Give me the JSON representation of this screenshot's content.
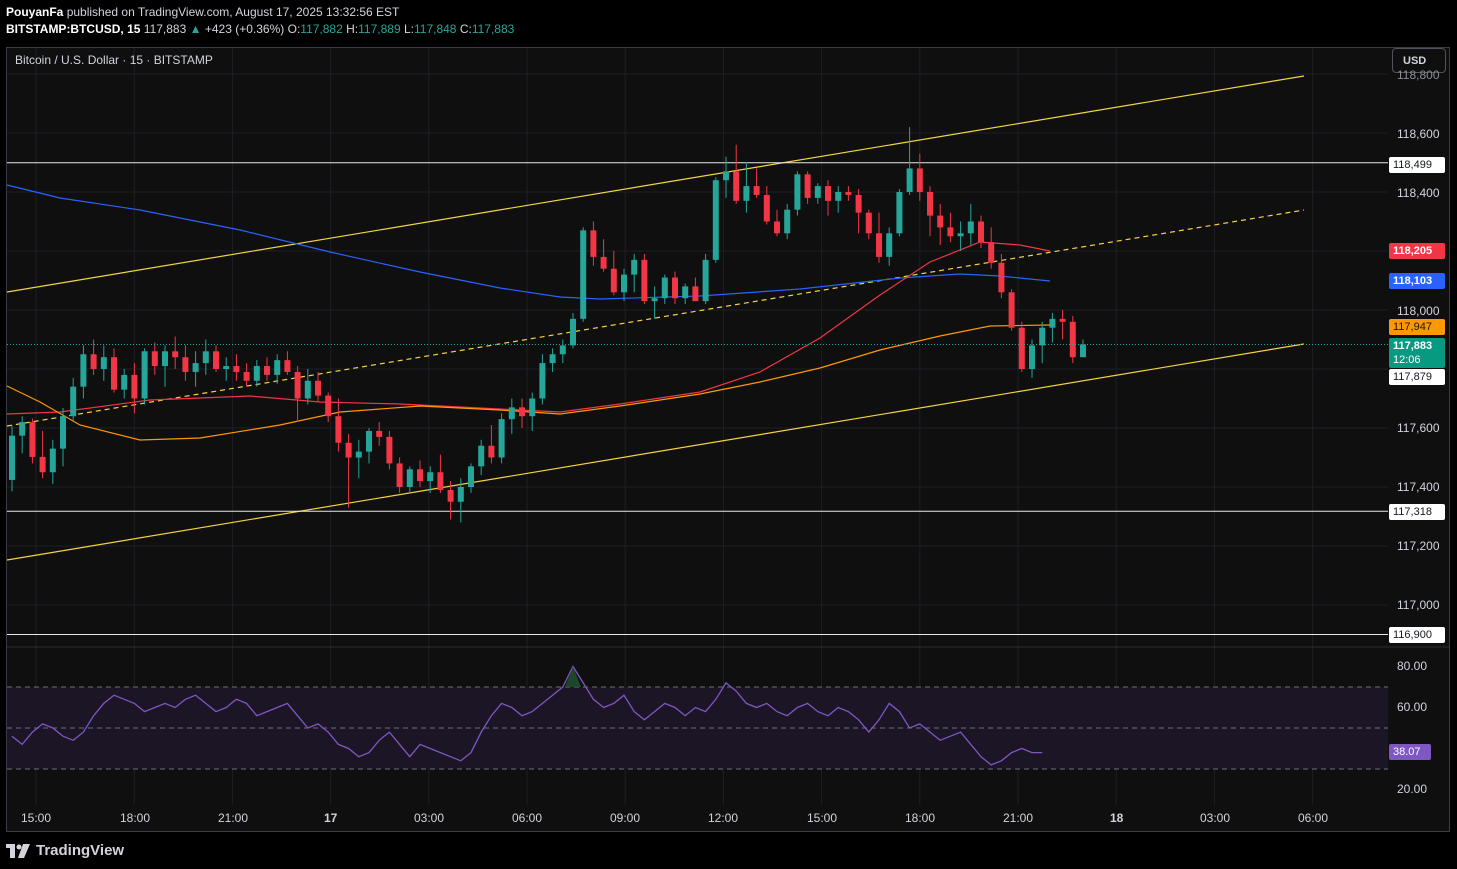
{
  "header": {
    "author": "PouyanFa",
    "published": "published on TradingView.com, August 17, 2025 13:32:56 EST",
    "symbol": "BITSTAMP:BTCUSD, 15",
    "last": "117,883",
    "change": "+423 (+0.36%)",
    "o_label": "O:",
    "o": "117,882",
    "h_label": "H:",
    "h": "117,889",
    "l_label": "L:",
    "l": "117,848",
    "c_label": "C:",
    "c": "117,883"
  },
  "legend_title": "Bitcoin / U.S. Dollar · 15 · BITSTAMP",
  "currency_button": "USD",
  "price_axis": {
    "labels": [
      "118,800",
      "118,600",
      "118,400",
      "118,000",
      "117,600",
      "117,400",
      "117,200",
      "117,000"
    ],
    "tags": {
      "h1": "118,499",
      "ema_red": "118,205",
      "ma_blue": "118,103",
      "ema_orange": "117,947",
      "last": "117,883",
      "countdown": "12:06",
      "cursor": "117,879",
      "h2": "117,318",
      "h3": "116,900"
    }
  },
  "rsi_axis": {
    "labels": [
      "80.00",
      "60.00",
      "20.00"
    ],
    "value": "38.07"
  },
  "time_axis": [
    "15:00",
    "18:00",
    "21:00",
    "17",
    "03:00",
    "06:00",
    "09:00",
    "12:00",
    "15:00",
    "18:00",
    "21:00",
    "18",
    "03:00",
    "06:00"
  ],
  "footer": {
    "brand": "TradingView"
  },
  "colors": {
    "up": "#26a69a",
    "down": "#f23645",
    "channel": "#f5d442",
    "ema_red": "#f23645",
    "ma_blue": "#2962ff",
    "ema_orange": "#ff9800",
    "rsi": "#7e57c2"
  },
  "chart_data": {
    "type": "candlestick",
    "symbol": "BITSTAMP:BTCUSD",
    "interval": "15",
    "candles_ohlc": [
      [
        117424,
        117608,
        117385,
        117574
      ],
      [
        117574,
        117640,
        117514,
        117620
      ],
      [
        117620,
        117632,
        117480,
        117502
      ],
      [
        117502,
        117590,
        117430,
        117450
      ],
      [
        117450,
        117560,
        117410,
        117530
      ],
      [
        117530,
        117668,
        117470,
        117640
      ],
      [
        117640,
        117770,
        117620,
        117740
      ],
      [
        117740,
        117880,
        117700,
        117850
      ],
      [
        117850,
        117900,
        117780,
        117800
      ],
      [
        117800,
        117880,
        117760,
        117840
      ],
      [
        117840,
        117870,
        117720,
        117730
      ],
      [
        117730,
        117800,
        117700,
        117780
      ],
      [
        117780,
        117820,
        117650,
        117700
      ],
      [
        117700,
        117870,
        117680,
        117860
      ],
      [
        117860,
        117890,
        117780,
        117810
      ],
      [
        117810,
        117880,
        117740,
        117860
      ],
      [
        117860,
        117910,
        117800,
        117840
      ],
      [
        117840,
        117880,
        117760,
        117790
      ],
      [
        117790,
        117860,
        117740,
        117820
      ],
      [
        117820,
        117900,
        117780,
        117860
      ],
      [
        117860,
        117880,
        117790,
        117800
      ],
      [
        117800,
        117840,
        117760,
        117810
      ],
      [
        117810,
        117850,
        117760,
        117790
      ],
      [
        117790,
        117820,
        117740,
        117760
      ],
      [
        117760,
        117830,
        117740,
        117810
      ],
      [
        117810,
        117840,
        117760,
        117780
      ],
      [
        117780,
        117850,
        117750,
        117830
      ],
      [
        117830,
        117860,
        117780,
        117790
      ],
      [
        117790,
        117810,
        117620,
        117700
      ],
      [
        117700,
        117800,
        117680,
        117760
      ],
      [
        117760,
        117790,
        117690,
        117710
      ],
      [
        117710,
        117720,
        117620,
        117640
      ],
      [
        117640,
        117700,
        117520,
        117550
      ],
      [
        117550,
        117580,
        117330,
        117500
      ],
      [
        117500,
        117560,
        117430,
        117520
      ],
      [
        117520,
        117600,
        117480,
        117590
      ],
      [
        117590,
        117620,
        117540,
        117570
      ],
      [
        117570,
        117590,
        117460,
        117480
      ],
      [
        117480,
        117500,
        117380,
        117400
      ],
      [
        117400,
        117470,
        117380,
        117460
      ],
      [
        117460,
        117490,
        117400,
        117420
      ],
      [
        117420,
        117470,
        117380,
        117450
      ],
      [
        117450,
        117510,
        117380,
        117390
      ],
      [
        117390,
        117420,
        117290,
        117350
      ],
      [
        117350,
        117430,
        117280,
        117400
      ],
      [
        117400,
        117480,
        117380,
        117470
      ],
      [
        117470,
        117560,
        117440,
        117540
      ],
      [
        117540,
        117610,
        117480,
        117500
      ],
      [
        117500,
        117650,
        117480,
        117630
      ],
      [
        117630,
        117700,
        117580,
        117670
      ],
      [
        117670,
        117700,
        117600,
        117640
      ],
      [
        117640,
        117720,
        117590,
        117700
      ],
      [
        117700,
        117850,
        117680,
        117820
      ],
      [
        117820,
        117870,
        117790,
        117850
      ],
      [
        117850,
        117900,
        117820,
        117880
      ],
      [
        117880,
        117990,
        117870,
        117970
      ],
      [
        117970,
        118280,
        117960,
        118270
      ],
      [
        118270,
        118300,
        118150,
        118180
      ],
      [
        118180,
        118240,
        118130,
        118140
      ],
      [
        118140,
        118200,
        118050,
        118060
      ],
      [
        118060,
        118140,
        118030,
        118120
      ],
      [
        118120,
        118190,
        118060,
        118170
      ],
      [
        118170,
        118190,
        118020,
        118030
      ],
      [
        118030,
        118080,
        117970,
        118040
      ],
      [
        118040,
        118120,
        118020,
        118110
      ],
      [
        118110,
        118130,
        118020,
        118040
      ],
      [
        118040,
        118090,
        118020,
        118080
      ],
      [
        118080,
        118110,
        118030,
        118030
      ],
      [
        118030,
        118190,
        118020,
        118170
      ],
      [
        118170,
        118450,
        118160,
        118440
      ],
      [
        118440,
        118520,
        118380,
        118470
      ],
      [
        118470,
        118560,
        118360,
        118370
      ],
      [
        118370,
        118500,
        118330,
        118420
      ],
      [
        118420,
        118480,
        118380,
        118390
      ],
      [
        118390,
        118420,
        118290,
        118300
      ],
      [
        118300,
        118340,
        118250,
        118260
      ],
      [
        118260,
        118360,
        118240,
        118340
      ],
      [
        118340,
        118470,
        118320,
        118460
      ],
      [
        118460,
        118470,
        118360,
        118380
      ],
      [
        118380,
        118430,
        118360,
        118420
      ],
      [
        118420,
        118440,
        118320,
        118370
      ],
      [
        118370,
        118420,
        118330,
        118400
      ],
      [
        118400,
        118420,
        118370,
        118390
      ],
      [
        118390,
        118410,
        118260,
        118330
      ],
      [
        118330,
        118340,
        118240,
        118260
      ],
      [
        118260,
        118330,
        118160,
        118180
      ],
      [
        118180,
        118280,
        118150,
        118260
      ],
      [
        118260,
        118410,
        118250,
        118400
      ],
      [
        118400,
        118620,
        118390,
        118480
      ],
      [
        118480,
        118530,
        118370,
        118400
      ],
      [
        118400,
        118420,
        118250,
        118320
      ],
      [
        118320,
        118360,
        118220,
        118280
      ],
      [
        118280,
        118330,
        118230,
        118250
      ],
      [
        118250,
        118300,
        118200,
        118260
      ],
      [
        118260,
        118360,
        118220,
        118300
      ],
      [
        118300,
        118320,
        118210,
        118230
      ],
      [
        118230,
        118280,
        118140,
        118160
      ],
      [
        118160,
        118190,
        118040,
        118060
      ],
      [
        118060,
        118070,
        117930,
        117940
      ],
      [
        117940,
        117960,
        117790,
        117800
      ],
      [
        117800,
        117900,
        117770,
        117880
      ],
      [
        117880,
        117960,
        117820,
        117940
      ],
      [
        117940,
        117990,
        117890,
        117970
      ],
      [
        117970,
        118000,
        117900,
        117960
      ],
      [
        117960,
        117980,
        117820,
        117840
      ],
      [
        117840,
        117900,
        117848,
        117883
      ]
    ],
    "horizontal_levels": [
      118499,
      117318,
      116900
    ],
    "indicators": {
      "ema_red_last": 118205,
      "ma_blue_last": 118103,
      "ema_orange_last": 117947
    },
    "rsi": {
      "upper_band": 70,
      "middle": 50,
      "lower_band": 30,
      "last": 38.07,
      "values": [
        46,
        42,
        48,
        52,
        50,
        46,
        44,
        48,
        56,
        62,
        66,
        64,
        62,
        58,
        60,
        62,
        60,
        64,
        66,
        62,
        58,
        60,
        64,
        62,
        56,
        58,
        60,
        62,
        56,
        50,
        52,
        48,
        42,
        40,
        36,
        38,
        44,
        48,
        42,
        36,
        42,
        40,
        38,
        36,
        34,
        38,
        48,
        56,
        62,
        60,
        56,
        58,
        62,
        66,
        70,
        80,
        72,
        64,
        60,
        62,
        66,
        58,
        54,
        58,
        62,
        60,
        56,
        60,
        58,
        64,
        72,
        68,
        62,
        60,
        62,
        58,
        56,
        60,
        62,
        58,
        56,
        60,
        58,
        54,
        48,
        54,
        62,
        58,
        50,
        52,
        48,
        44,
        46,
        48,
        42,
        36,
        32,
        34,
        38,
        40,
        38,
        38
      ]
    }
  }
}
